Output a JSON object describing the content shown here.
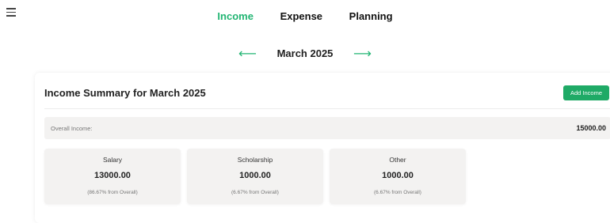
{
  "nav": {
    "tabs": [
      {
        "label": "Income",
        "active": true
      },
      {
        "label": "Expense",
        "active": false
      },
      {
        "label": "Planning",
        "active": false
      }
    ]
  },
  "period": {
    "prev_symbol": "⟵",
    "label": "March 2025",
    "next_symbol": "⟶"
  },
  "summary": {
    "title": "Income Summary for March 2025",
    "add_button": "Add Income",
    "overall_label": "Overall Income:",
    "overall_value": "15000.00"
  },
  "categories": [
    {
      "name": "Salary",
      "amount": "13000.00",
      "percent_text": "(86.67% from Overall)"
    },
    {
      "name": "Scholarship",
      "amount": "1000.00",
      "percent_text": "(6.67% from Overall)"
    },
    {
      "name": "Other",
      "amount": "1000.00",
      "percent_text": "(6.67% from Overall)"
    }
  ],
  "colors": {
    "accent": "#22b573",
    "button": "#1faa66",
    "card_bg": "#f3f2f1"
  }
}
